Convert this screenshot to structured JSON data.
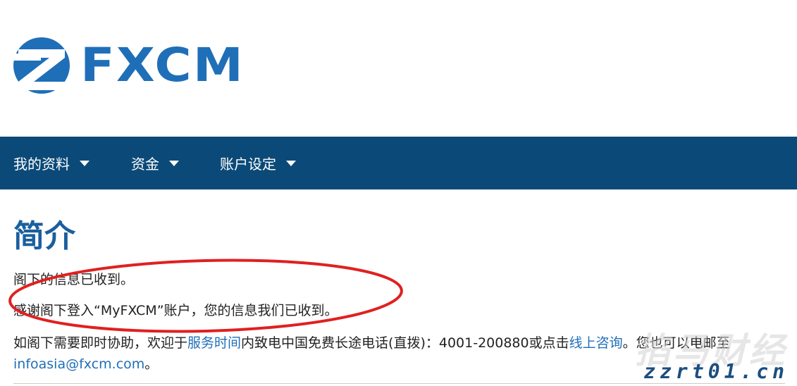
{
  "brand": {
    "logo_text": "FXCM",
    "accent_color": "#1f6fb8",
    "logo_icon": "fxcm-logo-icon"
  },
  "nav": {
    "background_color": "#0b4a78",
    "items": [
      {
        "label": "我的资料",
        "icon": "caret-down-icon"
      },
      {
        "label": "资金",
        "icon": "caret-down-icon"
      },
      {
        "label": "账户设定",
        "icon": "caret-down-icon"
      }
    ]
  },
  "main": {
    "title": "简介",
    "line1": "阁下的信息已收到。",
    "line2": "感谢阁下登入“MyFXCM”账户，您的信息我们已收到。",
    "line3_prefix": "如阁下需要即时协助，欢迎于",
    "line3_link1": "服务时间",
    "line3_middle": "内致电中国免费长途电话(直拨)：4001-200880或点击",
    "line3_link2": "线上咨询",
    "line3_suffix": "。您也可以电邮至",
    "email": "infoasia@fxcm.com",
    "email_suffix": "。"
  },
  "annotation": {
    "shape": "red-ellipse",
    "color": "#e02020"
  },
  "watermark": {
    "cn_text": "掐马财经",
    "url_text": "zzrt01.cn"
  }
}
